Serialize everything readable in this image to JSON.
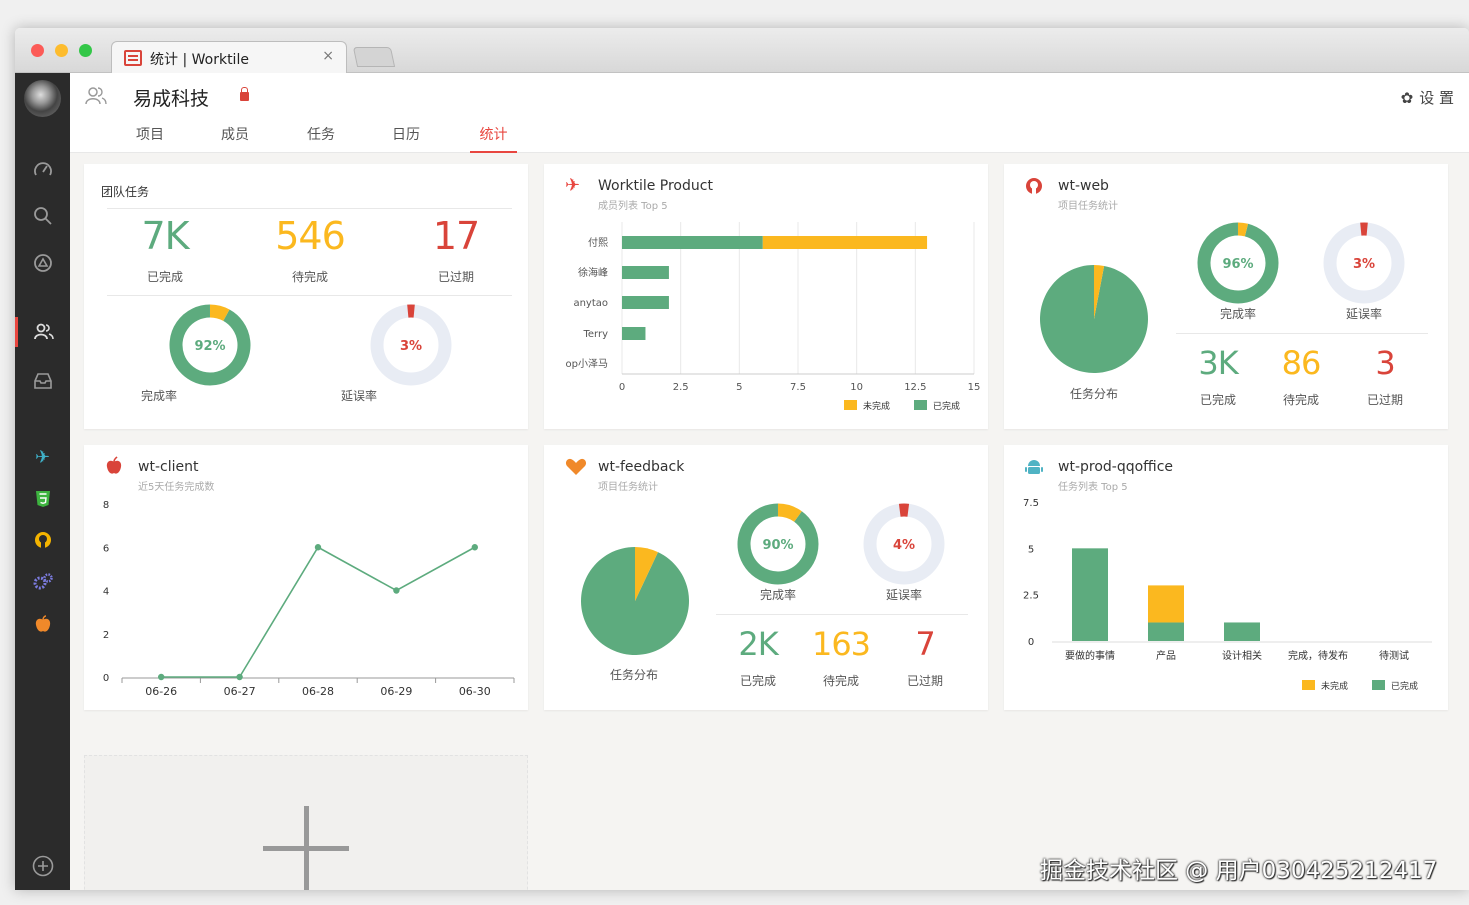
{
  "browser": {
    "tab_title": "统计 | Worktile",
    "close": "×"
  },
  "header": {
    "team_name": "易成科技",
    "settings_label": "设 置",
    "settings_icon": "gear-icon"
  },
  "nav": {
    "tabs": [
      "项目",
      "成员",
      "任务",
      "日历",
      "统计"
    ],
    "active": "统计"
  },
  "colors": {
    "green": "#5dab7e",
    "yellow": "#fbb81f",
    "red": "#d9443a",
    "ring_bg": "#e8ecf4",
    "accent": "#e8463f"
  },
  "team_tasks": {
    "title": "团队任务",
    "done": "7K",
    "done_label": "已完成",
    "pending": "546",
    "pending_label": "待完成",
    "overdue": "17",
    "overdue_label": "已过期",
    "completion_rate": "92%",
    "completion_label": "完成率",
    "completion_value": 92,
    "delay_rate": "3%",
    "delay_label": "延误率",
    "delay_value": 3
  },
  "worktile_product": {
    "title": "Worktile Product",
    "subtitle": "成员列表 Top 5"
  },
  "wt_web": {
    "title": "wt-web",
    "subtitle": "项目任务统计",
    "pie_label": "任务分布",
    "pie_done_fraction": 0.97,
    "completion_rate": "96%",
    "completion_label": "完成率",
    "completion_value": 96,
    "delay_rate": "3%",
    "delay_label": "延误率",
    "delay_value": 3,
    "done": "3K",
    "done_label": "已完成",
    "pending": "86",
    "pending_label": "待完成",
    "overdue": "3",
    "overdue_label": "已过期"
  },
  "wt_client": {
    "title": "wt-client",
    "subtitle": "近5天任务完成数"
  },
  "wt_feedback": {
    "title": "wt-feedback",
    "subtitle": "项目任务统计",
    "pie_label": "任务分布",
    "pie_done_fraction": 0.93,
    "completion_rate": "90%",
    "completion_label": "完成率",
    "completion_value": 90,
    "delay_rate": "4%",
    "delay_label": "延误率",
    "delay_value": 4,
    "done": "2K",
    "done_label": "已完成",
    "pending": "163",
    "pending_label": "待完成",
    "overdue": "7",
    "overdue_label": "已过期"
  },
  "wt_prod": {
    "title": "wt-prod-qqoffice",
    "subtitle": "任务列表 Top 5"
  },
  "watermark": "掘金技术社区 @ 用户030425212417",
  "chart_data": [
    {
      "type": "bar",
      "orientation": "horizontal",
      "categories": [
        "付熙",
        "徐海峰",
        "anytao",
        "Terry",
        "op小泽马"
      ],
      "series": [
        {
          "name": "已完成",
          "values": [
            6,
            2,
            2,
            1,
            0
          ]
        },
        {
          "name": "未完成",
          "values": [
            7,
            0,
            0,
            0,
            0
          ]
        }
      ],
      "xticks": [
        "0",
        "2.5",
        "5",
        "7.5",
        "10",
        "12.5",
        "15"
      ],
      "xlim": [
        0,
        15
      ],
      "legend": [
        "未完成",
        "已完成"
      ],
      "legend_position": "bottom-right",
      "grid": true
    },
    {
      "type": "line",
      "x": [
        "06-26",
        "06-27",
        "06-28",
        "06-29",
        "06-30"
      ],
      "series": [
        {
          "values": [
            0,
            0,
            6,
            4,
            6
          ]
        }
      ],
      "yticks": [
        "0",
        "2",
        "4",
        "6",
        "8"
      ],
      "ylim": [
        0,
        8
      ]
    },
    {
      "type": "bar",
      "stacked": true,
      "categories": [
        "要做的事情",
        "产品",
        "设计相关",
        "完成，待发布",
        "待测试"
      ],
      "series": [
        {
          "name": "已完成",
          "values": [
            5,
            1,
            1,
            0,
            0
          ]
        },
        {
          "name": "未完成",
          "values": [
            0,
            2,
            0,
            0,
            0
          ]
        }
      ],
      "yticks": [
        "0",
        "2.5",
        "5",
        "7.5"
      ],
      "ylim": [
        0,
        7.5
      ],
      "legend": [
        "未完成",
        "已完成"
      ],
      "legend_position": "bottom-right"
    }
  ]
}
